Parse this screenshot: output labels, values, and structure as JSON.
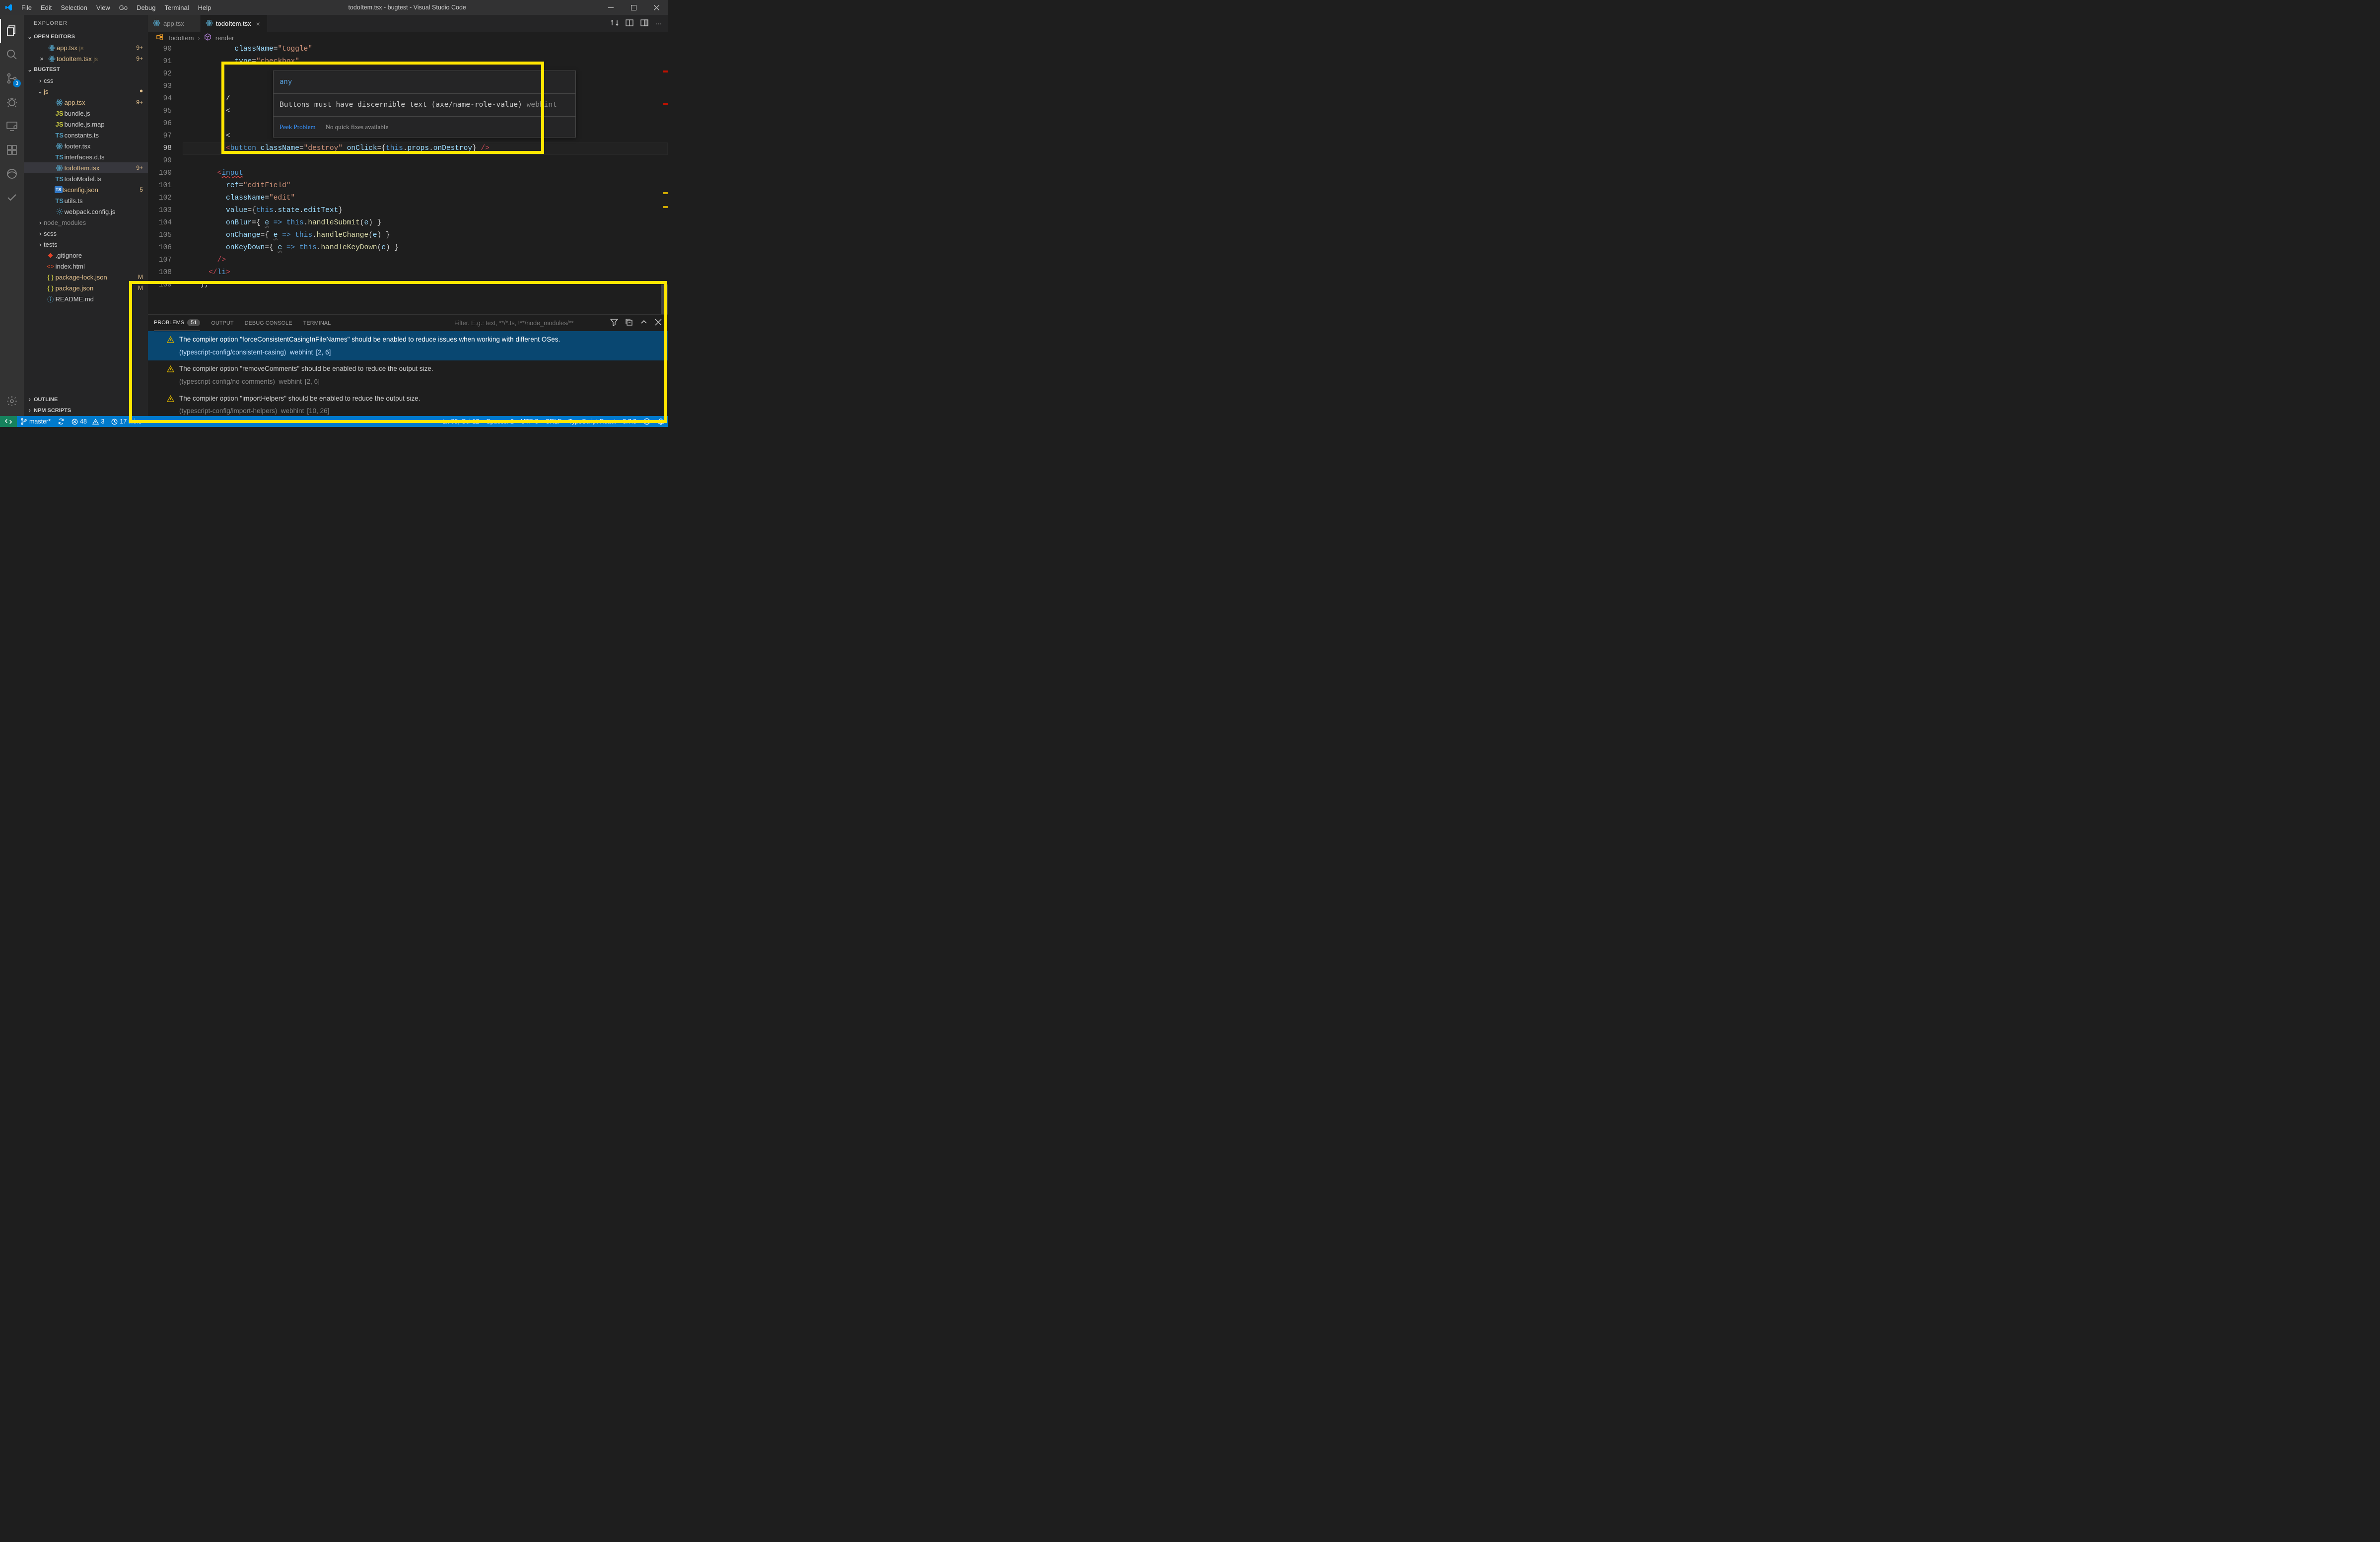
{
  "title": "todoItem.tsx - bugtest - Visual Studio Code",
  "menu": [
    "File",
    "Edit",
    "Selection",
    "View",
    "Go",
    "Debug",
    "Terminal",
    "Help"
  ],
  "activity": {
    "scm_badge": "3"
  },
  "sidebar": {
    "title": "EXPLORER",
    "openEditors": "OPEN EDITORS",
    "openItems": [
      {
        "label": "app.tsx",
        "meta": "js",
        "deco": "9+"
      },
      {
        "label": "todoItem.tsx",
        "meta": "js",
        "deco": "9+"
      }
    ],
    "folder": "BUGTEST",
    "tree": [
      {
        "type": "folder",
        "label": "css",
        "indent": 18,
        "open": false
      },
      {
        "type": "folder",
        "label": "js",
        "indent": 18,
        "open": true,
        "mod": true
      },
      {
        "type": "file",
        "label": "app.tsx",
        "icon": "react",
        "indent": 36,
        "mod": true,
        "deco": "9+"
      },
      {
        "type": "file",
        "label": "bundle.js",
        "icon": "js",
        "indent": 36
      },
      {
        "type": "file",
        "label": "bundle.js.map",
        "icon": "js",
        "indent": 36
      },
      {
        "type": "file",
        "label": "constants.ts",
        "icon": "ts",
        "indent": 36
      },
      {
        "type": "file",
        "label": "footer.tsx",
        "icon": "react",
        "indent": 36
      },
      {
        "type": "file",
        "label": "interfaces.d.ts",
        "icon": "ts",
        "indent": 36
      },
      {
        "type": "file",
        "label": "todoItem.tsx",
        "icon": "react",
        "indent": 36,
        "mod": true,
        "deco": "9+",
        "sel": true
      },
      {
        "type": "file",
        "label": "todoModel.ts",
        "icon": "ts",
        "indent": 36
      },
      {
        "type": "file",
        "label": "tsconfig.json",
        "icon": "tsjson",
        "indent": 36,
        "mod": true,
        "deco": "5"
      },
      {
        "type": "file",
        "label": "utils.ts",
        "icon": "ts",
        "indent": 36
      },
      {
        "type": "file",
        "label": "webpack.config.js",
        "icon": "cfg",
        "indent": 36
      },
      {
        "type": "folder",
        "label": "node_modules",
        "indent": 18,
        "open": false,
        "dim": true
      },
      {
        "type": "folder",
        "label": "scss",
        "indent": 18,
        "open": false
      },
      {
        "type": "folder",
        "label": "tests",
        "indent": 18,
        "open": false
      },
      {
        "type": "file",
        "label": ".gitignore",
        "icon": "git",
        "indent": 18
      },
      {
        "type": "file",
        "label": "index.html",
        "icon": "html",
        "indent": 18
      },
      {
        "type": "file",
        "label": "package-lock.json",
        "icon": "json",
        "indent": 18,
        "mod": true,
        "deco": "M"
      },
      {
        "type": "file",
        "label": "package.json",
        "icon": "json",
        "indent": 18,
        "mod": true,
        "deco": "M"
      },
      {
        "type": "file",
        "label": "README.md",
        "icon": "info",
        "indent": 18
      }
    ],
    "outline": "OUTLINE",
    "npm": "NPM SCRIPTS"
  },
  "tabs": [
    {
      "label": "app.tsx",
      "active": false
    },
    {
      "label": "todoItem.tsx",
      "active": true
    }
  ],
  "breadcrumbs": {
    "item1": "TodoItem",
    "item2": "render"
  },
  "hover": {
    "type": "any",
    "msg": "Buttons must have discernible text (axe/name-role-value)",
    "src": "webhint",
    "peek": "Peek Problem",
    "noqf": "No quick fixes available"
  },
  "lines": [
    "90",
    "91",
    "92",
    "93",
    "94",
    "95",
    "96",
    "97",
    "98",
    "99",
    "100",
    "101",
    "102",
    "103",
    "104",
    "105",
    "106",
    "107",
    "108",
    "109"
  ],
  "panel": {
    "problems": "PROBLEMS",
    "count": "51",
    "output": "OUTPUT",
    "debug": "DEBUG CONSOLE",
    "terminal": "TERMINAL",
    "filter": "Filter. E.g.: text, **/*.ts, !**/node_modules/**",
    "items": [
      {
        "msg": "The compiler option \"forceConsistentCasingInFileNames\" should be enabled to reduce issues when working with different OSes.",
        "rule": "(typescript-config/consistent-casing)",
        "src": "webhint",
        "loc": "[2, 6]",
        "sel": true
      },
      {
        "msg": "The compiler option \"removeComments\" should be enabled to reduce the output size.",
        "rule": "(typescript-config/no-comments)",
        "src": "webhint",
        "loc": "[2, 6]"
      },
      {
        "msg": "The compiler option \"importHelpers\" should be enabled to reduce the output size.",
        "rule": "(typescript-config/import-helpers)",
        "src": "webhint",
        "loc": "[10, 26]"
      }
    ]
  },
  "status": {
    "branch": "master*",
    "errors": "48",
    "warnings": "3",
    "clock": "17 mins",
    "pos": "Ln 98, Col 12",
    "spaces": "Spaces: 2",
    "enc": "UTF-8",
    "eol": "CRLF",
    "lang": "TypeScript React",
    "ver": "3.7.3"
  }
}
